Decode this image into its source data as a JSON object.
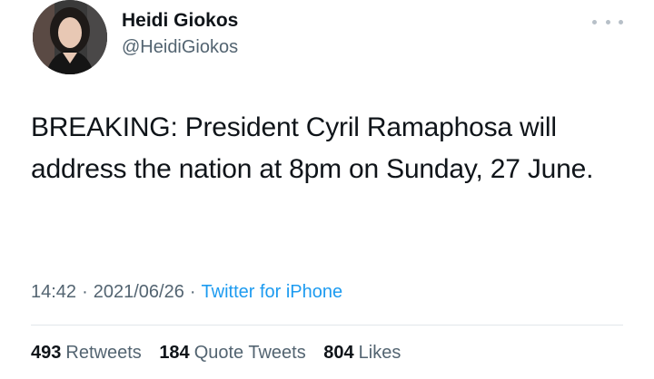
{
  "author": {
    "name": "Heidi Giokos",
    "handle": "@HeidiGiokos",
    "avatar_icon": "profile-photo"
  },
  "more_icon": "more-horizontal-icon",
  "tweet": {
    "text": "BREAKING: President Cyril Ramaphosa will address the nation at 8pm on Sunday, 27 June."
  },
  "meta": {
    "time": "14:42",
    "separator": "·",
    "date": "2021/06/26",
    "source": "Twitter for iPhone"
  },
  "stats": {
    "retweets_count": "493",
    "retweets_label": "Retweets",
    "quotes_count": "184",
    "quotes_label": "Quote Tweets",
    "likes_count": "804",
    "likes_label": "Likes"
  },
  "colors": {
    "text": "#0f1419",
    "secondary": "#536471",
    "link": "#1d9bf0",
    "divider": "#e1e6ea"
  }
}
